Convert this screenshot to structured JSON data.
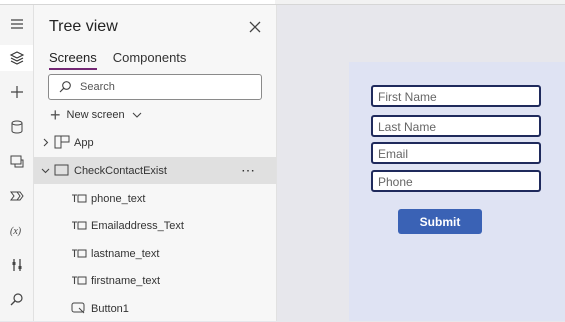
{
  "panel": {
    "title": "Tree view",
    "tabs": [
      {
        "label": "Screens"
      },
      {
        "label": "Components"
      }
    ],
    "search_placeholder": "Search",
    "new_screen_label": "New screen"
  },
  "tree": {
    "app": "App",
    "screen": "CheckContactExist",
    "items": [
      {
        "label": "phone_text"
      },
      {
        "label": "Emailaddress_Text"
      },
      {
        "label": "lastname_text"
      },
      {
        "label": "firstname_text"
      },
      {
        "label": "Button1"
      }
    ]
  },
  "form": {
    "fields": [
      {
        "placeholder": "First Name"
      },
      {
        "placeholder": "Last Name"
      },
      {
        "placeholder": "Email"
      },
      {
        "placeholder": "Phone"
      }
    ],
    "submit_label": "Submit"
  },
  "colors": {
    "accent_tab": "#742774",
    "button": "#3a62b5",
    "field_border": "#1f2a5c",
    "form_bg": "#dfe3f3"
  },
  "icons": [
    "hamburger-icon",
    "layers-icon",
    "plus-icon",
    "database-icon",
    "media-icon",
    "power-automate-icon",
    "variables-icon",
    "tools-icon",
    "search-icon"
  ]
}
